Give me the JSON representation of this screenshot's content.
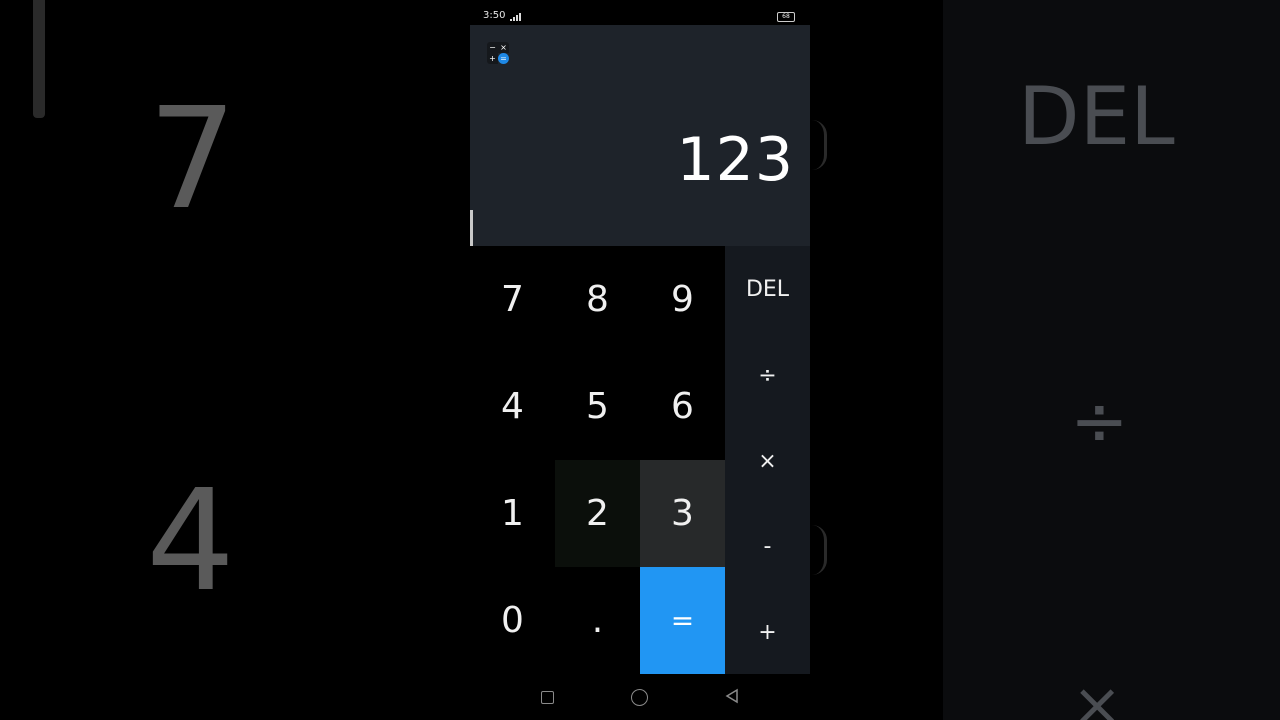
{
  "status_bar": {
    "time": "3:50",
    "battery": "68"
  },
  "display": {
    "result": "123"
  },
  "app_icon": {
    "minus": "−",
    "times": "×",
    "plus": "+",
    "equals": "="
  },
  "keypad": {
    "k7": "7",
    "k8": "8",
    "k9": "9",
    "k4": "4",
    "k5": "5",
    "k6": "6",
    "k1": "1",
    "k2": "2",
    "k3": "3",
    "k0": "0",
    "dot": ".",
    "equals": "="
  },
  "operators": {
    "del": "DEL",
    "divide": "÷",
    "multiply": "×",
    "subtract": "-",
    "add": "+"
  },
  "background_echo": {
    "seven": "7",
    "four": "4",
    "del": "DEL",
    "divide": "÷",
    "multiply": "×"
  },
  "colors": {
    "display_bg": "#1e232a",
    "ops_bg": "#15191f",
    "equals_accent": "#2196f3"
  }
}
